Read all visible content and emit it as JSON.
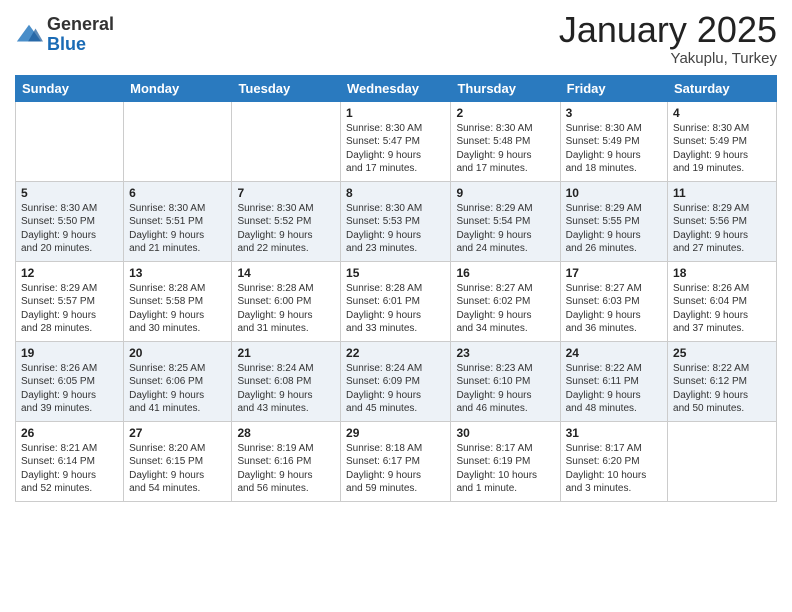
{
  "logo": {
    "general": "General",
    "blue": "Blue"
  },
  "header": {
    "month": "January 2025",
    "location": "Yakuplu, Turkey"
  },
  "weekdays": [
    "Sunday",
    "Monday",
    "Tuesday",
    "Wednesday",
    "Thursday",
    "Friday",
    "Saturday"
  ],
  "weeks": [
    [
      {
        "day": "",
        "info": ""
      },
      {
        "day": "",
        "info": ""
      },
      {
        "day": "",
        "info": ""
      },
      {
        "day": "1",
        "info": "Sunrise: 8:30 AM\nSunset: 5:47 PM\nDaylight: 9 hours\nand 17 minutes."
      },
      {
        "day": "2",
        "info": "Sunrise: 8:30 AM\nSunset: 5:48 PM\nDaylight: 9 hours\nand 17 minutes."
      },
      {
        "day": "3",
        "info": "Sunrise: 8:30 AM\nSunset: 5:49 PM\nDaylight: 9 hours\nand 18 minutes."
      },
      {
        "day": "4",
        "info": "Sunrise: 8:30 AM\nSunset: 5:49 PM\nDaylight: 9 hours\nand 19 minutes."
      }
    ],
    [
      {
        "day": "5",
        "info": "Sunrise: 8:30 AM\nSunset: 5:50 PM\nDaylight: 9 hours\nand 20 minutes."
      },
      {
        "day": "6",
        "info": "Sunrise: 8:30 AM\nSunset: 5:51 PM\nDaylight: 9 hours\nand 21 minutes."
      },
      {
        "day": "7",
        "info": "Sunrise: 8:30 AM\nSunset: 5:52 PM\nDaylight: 9 hours\nand 22 minutes."
      },
      {
        "day": "8",
        "info": "Sunrise: 8:30 AM\nSunset: 5:53 PM\nDaylight: 9 hours\nand 23 minutes."
      },
      {
        "day": "9",
        "info": "Sunrise: 8:29 AM\nSunset: 5:54 PM\nDaylight: 9 hours\nand 24 minutes."
      },
      {
        "day": "10",
        "info": "Sunrise: 8:29 AM\nSunset: 5:55 PM\nDaylight: 9 hours\nand 26 minutes."
      },
      {
        "day": "11",
        "info": "Sunrise: 8:29 AM\nSunset: 5:56 PM\nDaylight: 9 hours\nand 27 minutes."
      }
    ],
    [
      {
        "day": "12",
        "info": "Sunrise: 8:29 AM\nSunset: 5:57 PM\nDaylight: 9 hours\nand 28 minutes."
      },
      {
        "day": "13",
        "info": "Sunrise: 8:28 AM\nSunset: 5:58 PM\nDaylight: 9 hours\nand 30 minutes."
      },
      {
        "day": "14",
        "info": "Sunrise: 8:28 AM\nSunset: 6:00 PM\nDaylight: 9 hours\nand 31 minutes."
      },
      {
        "day": "15",
        "info": "Sunrise: 8:28 AM\nSunset: 6:01 PM\nDaylight: 9 hours\nand 33 minutes."
      },
      {
        "day": "16",
        "info": "Sunrise: 8:27 AM\nSunset: 6:02 PM\nDaylight: 9 hours\nand 34 minutes."
      },
      {
        "day": "17",
        "info": "Sunrise: 8:27 AM\nSunset: 6:03 PM\nDaylight: 9 hours\nand 36 minutes."
      },
      {
        "day": "18",
        "info": "Sunrise: 8:26 AM\nSunset: 6:04 PM\nDaylight: 9 hours\nand 37 minutes."
      }
    ],
    [
      {
        "day": "19",
        "info": "Sunrise: 8:26 AM\nSunset: 6:05 PM\nDaylight: 9 hours\nand 39 minutes."
      },
      {
        "day": "20",
        "info": "Sunrise: 8:25 AM\nSunset: 6:06 PM\nDaylight: 9 hours\nand 41 minutes."
      },
      {
        "day": "21",
        "info": "Sunrise: 8:24 AM\nSunset: 6:08 PM\nDaylight: 9 hours\nand 43 minutes."
      },
      {
        "day": "22",
        "info": "Sunrise: 8:24 AM\nSunset: 6:09 PM\nDaylight: 9 hours\nand 45 minutes."
      },
      {
        "day": "23",
        "info": "Sunrise: 8:23 AM\nSunset: 6:10 PM\nDaylight: 9 hours\nand 46 minutes."
      },
      {
        "day": "24",
        "info": "Sunrise: 8:22 AM\nSunset: 6:11 PM\nDaylight: 9 hours\nand 48 minutes."
      },
      {
        "day": "25",
        "info": "Sunrise: 8:22 AM\nSunset: 6:12 PM\nDaylight: 9 hours\nand 50 minutes."
      }
    ],
    [
      {
        "day": "26",
        "info": "Sunrise: 8:21 AM\nSunset: 6:14 PM\nDaylight: 9 hours\nand 52 minutes."
      },
      {
        "day": "27",
        "info": "Sunrise: 8:20 AM\nSunset: 6:15 PM\nDaylight: 9 hours\nand 54 minutes."
      },
      {
        "day": "28",
        "info": "Sunrise: 8:19 AM\nSunset: 6:16 PM\nDaylight: 9 hours\nand 56 minutes."
      },
      {
        "day": "29",
        "info": "Sunrise: 8:18 AM\nSunset: 6:17 PM\nDaylight: 9 hours\nand 59 minutes."
      },
      {
        "day": "30",
        "info": "Sunrise: 8:17 AM\nSunset: 6:19 PM\nDaylight: 10 hours\nand 1 minute."
      },
      {
        "day": "31",
        "info": "Sunrise: 8:17 AM\nSunset: 6:20 PM\nDaylight: 10 hours\nand 3 minutes."
      },
      {
        "day": "",
        "info": ""
      }
    ]
  ]
}
